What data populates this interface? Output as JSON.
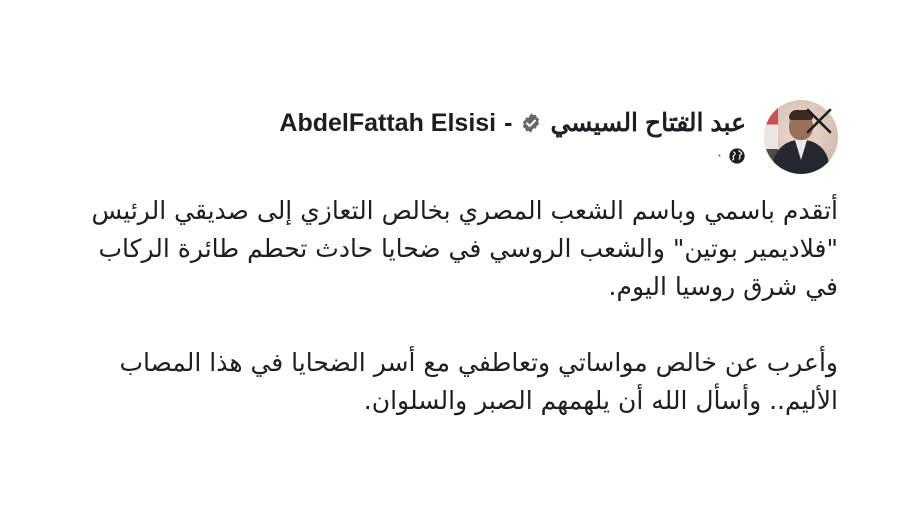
{
  "post": {
    "author_name_ar": "عبد  الفتاح  السيسي",
    "author_separator": "-",
    "author_name_en": "AbdelFattah Elsisi",
    "meta_dot": "·",
    "more_label": "···",
    "paragraphs": [
      {
        "lines": [
          "أتقدم باسمي وباسم الشعب المصري بخالص التعازي إلى صديقي الرئيس",
          "\"فلاديمير بوتين\" والشعب الروسي في ضحايا حادث تحطم طائرة الركاب",
          "في شرق روسيا اليوم."
        ]
      },
      {
        "lines": [
          "وأعرب عن خالص مواساتي وتعاطفي مع أسر الضحايا في هذا المصاب",
          "الأليم.. وأسأل الله أن يلهمهم الصبر والسلوان."
        ]
      }
    ]
  },
  "icons": {
    "verified": "verified-badge-icon",
    "privacy": "globe-icon",
    "close": "close-icon",
    "more": "more-options-icon"
  },
  "colors": {
    "text": "#1c1e21",
    "muted": "#65676b",
    "badge": "#65676b"
  }
}
